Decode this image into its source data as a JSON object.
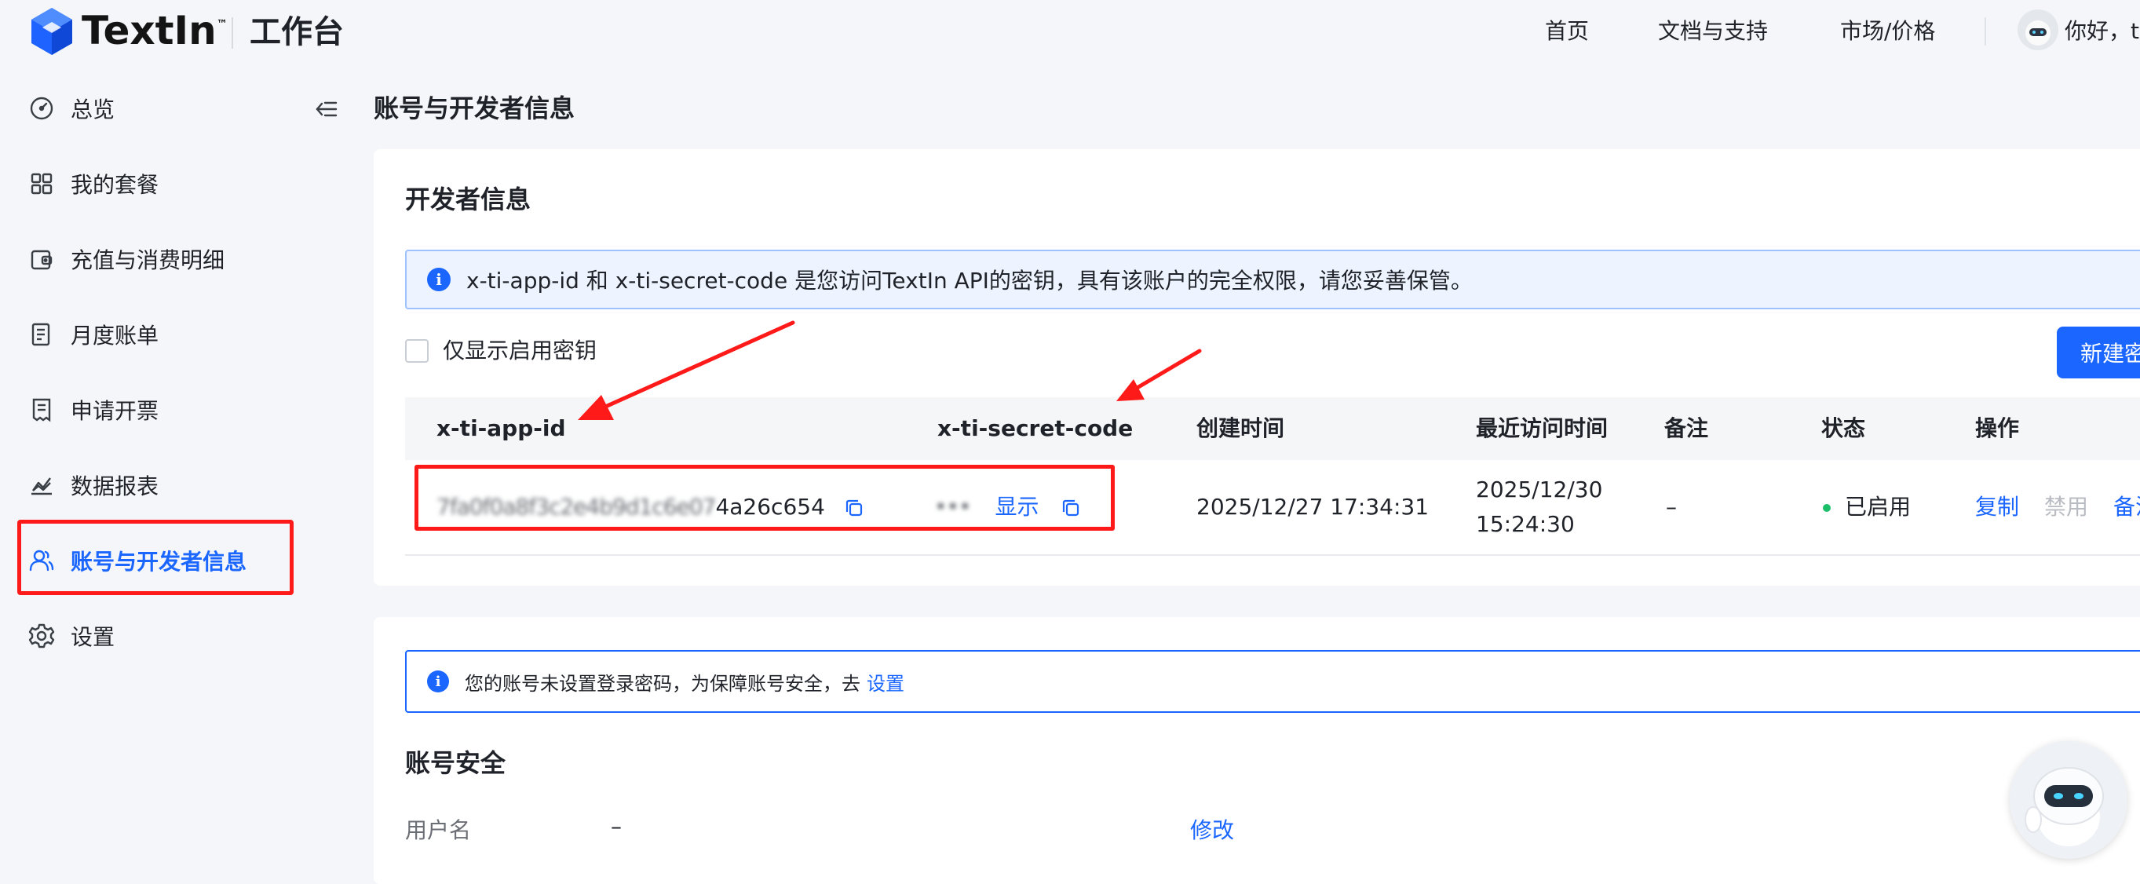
{
  "colors": {
    "accent": "#1a66ff",
    "highlight": "#ff1a1a",
    "status_enabled": "#1bbf6a",
    "page_bg": "#f4f6f9"
  },
  "header": {
    "brand": "TextIn",
    "brand_mark": "™",
    "section": "工作台",
    "nav": [
      "首页",
      "文档与支持",
      "市场/价格"
    ],
    "greeting": "你好，t"
  },
  "sidebar": {
    "items": [
      {
        "label": "总览",
        "icon": "dashboard-icon"
      },
      {
        "label": "我的套餐",
        "icon": "grid-icon"
      },
      {
        "label": "充值与消费明细",
        "icon": "wallet-icon"
      },
      {
        "label": "月度账单",
        "icon": "document-icon"
      },
      {
        "label": "申请开票",
        "icon": "receipt-icon"
      },
      {
        "label": "数据报表",
        "icon": "chart-icon"
      },
      {
        "label": "账号与开发者信息",
        "icon": "users-icon",
        "active": true
      },
      {
        "label": "设置",
        "icon": "gear-icon"
      }
    ]
  },
  "main": {
    "title": "账号与开发者信息",
    "developer": {
      "title": "开发者信息",
      "notice": "x-ti-app-id 和 x-ti-secret-code 是您访问TextIn API的密钥，具有该账户的完全权限，请您妥善保管。",
      "filter_label": "仅显示启用密钥",
      "new_button": "新建密",
      "columns": [
        "x-ti-app-id",
        "x-ti-secret-code",
        "创建时间",
        "最近访问时间",
        "备注",
        "状态",
        "操作"
      ],
      "rows": [
        {
          "app_id_masked": "7fa0f0a8f3c2e4b9d1c6e07",
          "app_id_visible": "4a26c654",
          "secret_masked": "•••",
          "show_label": "显示",
          "created": "2025/12/27 17:34:31",
          "last_access_date": "2025/12/30",
          "last_access_time": "15:24:30",
          "note": "–",
          "status": "已启用",
          "actions": [
            "复制",
            "禁用",
            "备注"
          ]
        }
      ]
    },
    "security": {
      "notice": "您的账号未设置登录密码，为保障账号安全，去",
      "notice_link": "设置",
      "title": "账号安全",
      "username_label": "用户名",
      "username_value": "–",
      "edit_label": "修改"
    }
  }
}
